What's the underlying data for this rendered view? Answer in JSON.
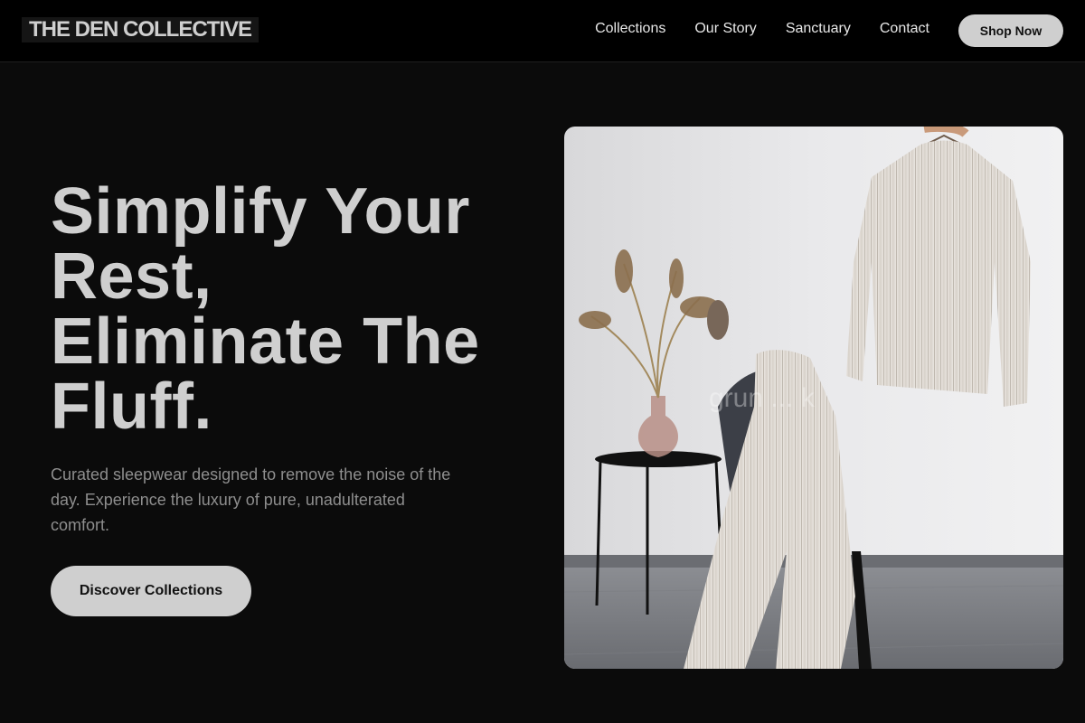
{
  "nav": {
    "logo": "THE DEN COLLECTIVE",
    "links": [
      "Collections",
      "Our Story",
      "Sanctuary",
      "Contact"
    ],
    "cta": "Shop Now"
  },
  "hero": {
    "title_lines": [
      "Simplify Your",
      "Rest,",
      "Eliminate The",
      "Fluff."
    ],
    "subtitle": "Curated sleepwear designed to remove the noise of the day. Experience the luxury of pure, unadulterated comfort.",
    "cta": "Discover Collections",
    "image_alt": "Ribbed knit sweater on hanger and matching pants draped over chair beside side table with dried grasses in vase",
    "watermark": "grun ... k"
  },
  "colors": {
    "background": "#0b0b0b",
    "nav_bg": "#000000",
    "text": "#cfcfcf",
    "muted": "#8e8e8e",
    "button": "#cfcfcf"
  }
}
